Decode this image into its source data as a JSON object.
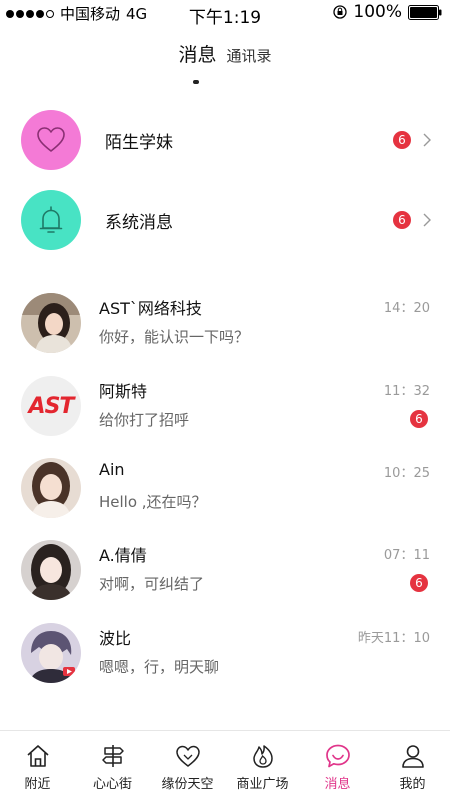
{
  "status_bar": {
    "carrier": "中国移动",
    "network": "4G",
    "time": "下午1:19",
    "battery": "100%"
  },
  "header": {
    "active_tab": "消息",
    "other_tab": "通讯录"
  },
  "features": [
    {
      "title": "陌生学妹",
      "badge": "6",
      "icon": "heart-icon",
      "color": "#f47ad6"
    },
    {
      "title": "系统消息",
      "badge": "6",
      "icon": "bell-icon",
      "color": "#48e3c4"
    }
  ],
  "chats": [
    {
      "name": "AST`网络科技",
      "preview": "你好，能认识一下吗？",
      "time": "14：20",
      "badge": ""
    },
    {
      "name": "阿斯特",
      "preview": "给你打了招呼",
      "time": "11：32",
      "badge": "6",
      "avatar_text": "AST"
    },
    {
      "name": "Ain",
      "preview": "Hello ,还在吗？",
      "time": "10：25",
      "badge": ""
    },
    {
      "name": "A.倩倩",
      "preview": "对啊，可纠结了",
      "time": "07：11",
      "badge": "6"
    },
    {
      "name": "波比",
      "preview": "嗯嗯，行，明天聊",
      "time": "昨天11：10",
      "badge": ""
    }
  ],
  "tabbar": [
    {
      "label": "附近",
      "icon": "home-icon",
      "active": false
    },
    {
      "label": "心心街",
      "icon": "signpost-icon",
      "active": false
    },
    {
      "label": "缘份天空",
      "icon": "hearts-icon",
      "active": false
    },
    {
      "label": "商业广场",
      "icon": "flame-icon",
      "active": false
    },
    {
      "label": "消息",
      "icon": "chat-bubble-icon",
      "active": true
    },
    {
      "label": "我的",
      "icon": "user-icon",
      "active": false
    }
  ],
  "colors": {
    "accent": "#e0358a",
    "badge": "#e53340"
  }
}
